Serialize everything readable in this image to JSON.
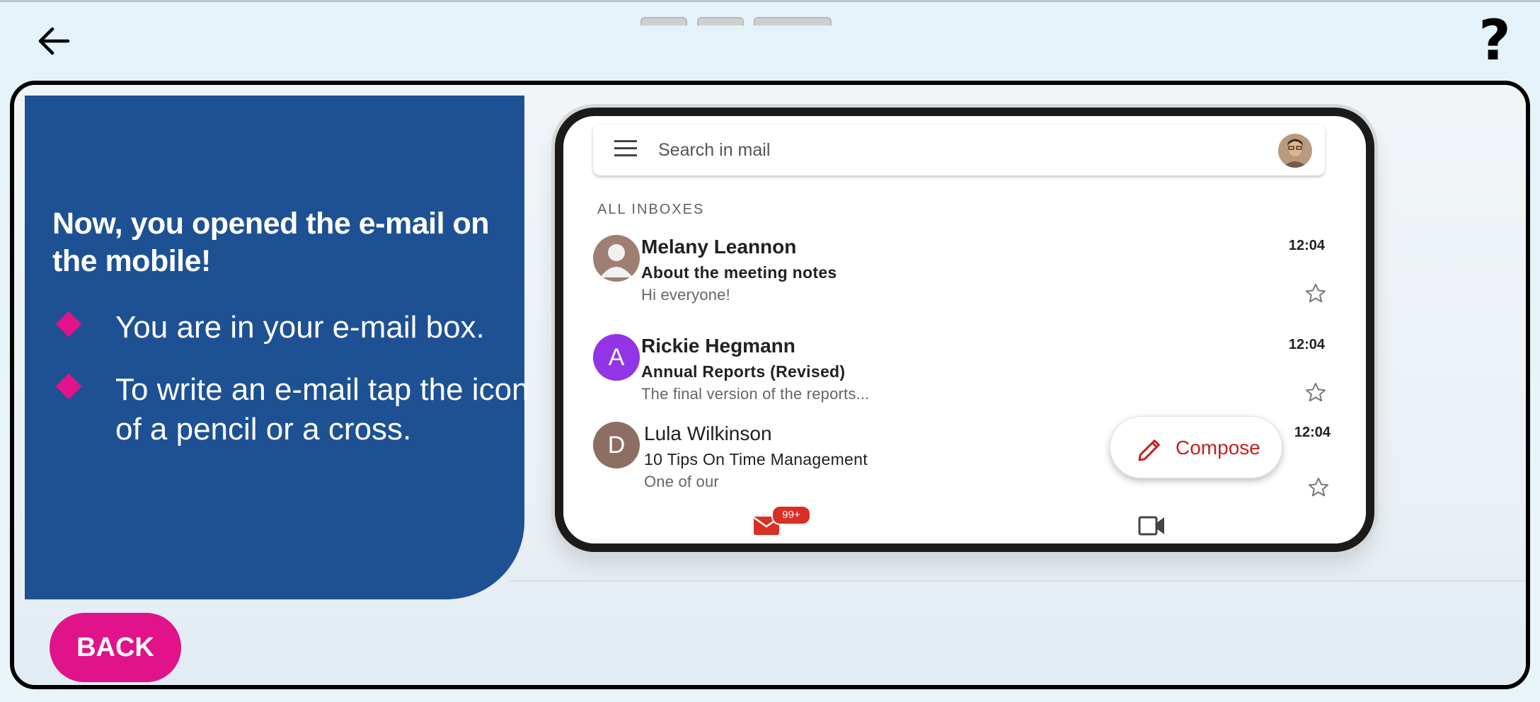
{
  "nav": {
    "back_icon": "arrow-left-icon",
    "help_label": "?"
  },
  "panel": {
    "title": "Now, you opened the e-mail on the mobile!",
    "bullets": [
      "You are in your e-mail box.",
      "To write an e-mail tap the icon of a pencil or a cross."
    ]
  },
  "back_button": {
    "label": "BACK"
  },
  "colors": {
    "panel_blue": "#1e5193",
    "accent_pink": "#e0138a",
    "gmail_red": "#d93025"
  },
  "phone": {
    "search_placeholder": "Search in mail",
    "section_label": "ALL INBOXES",
    "emails": [
      {
        "sender": "Melany Leannon",
        "subject": "About the meeting notes",
        "snippet": "Hi everyone!",
        "time": "12:04",
        "avatar": "person-icon"
      },
      {
        "sender": "Rickie Hegmann",
        "subject": "Annual Reports (Revised)",
        "snippet": "The final version of the reports...",
        "time": "12:04",
        "avatar_letter": "A"
      },
      {
        "sender": "Lula Wilkinson",
        "subject": "10 Tips On Time Management",
        "snippet": "One of our",
        "time": "12:04",
        "avatar_letter": "D"
      }
    ],
    "compose_label": "Compose",
    "mail_badge": "99+"
  }
}
